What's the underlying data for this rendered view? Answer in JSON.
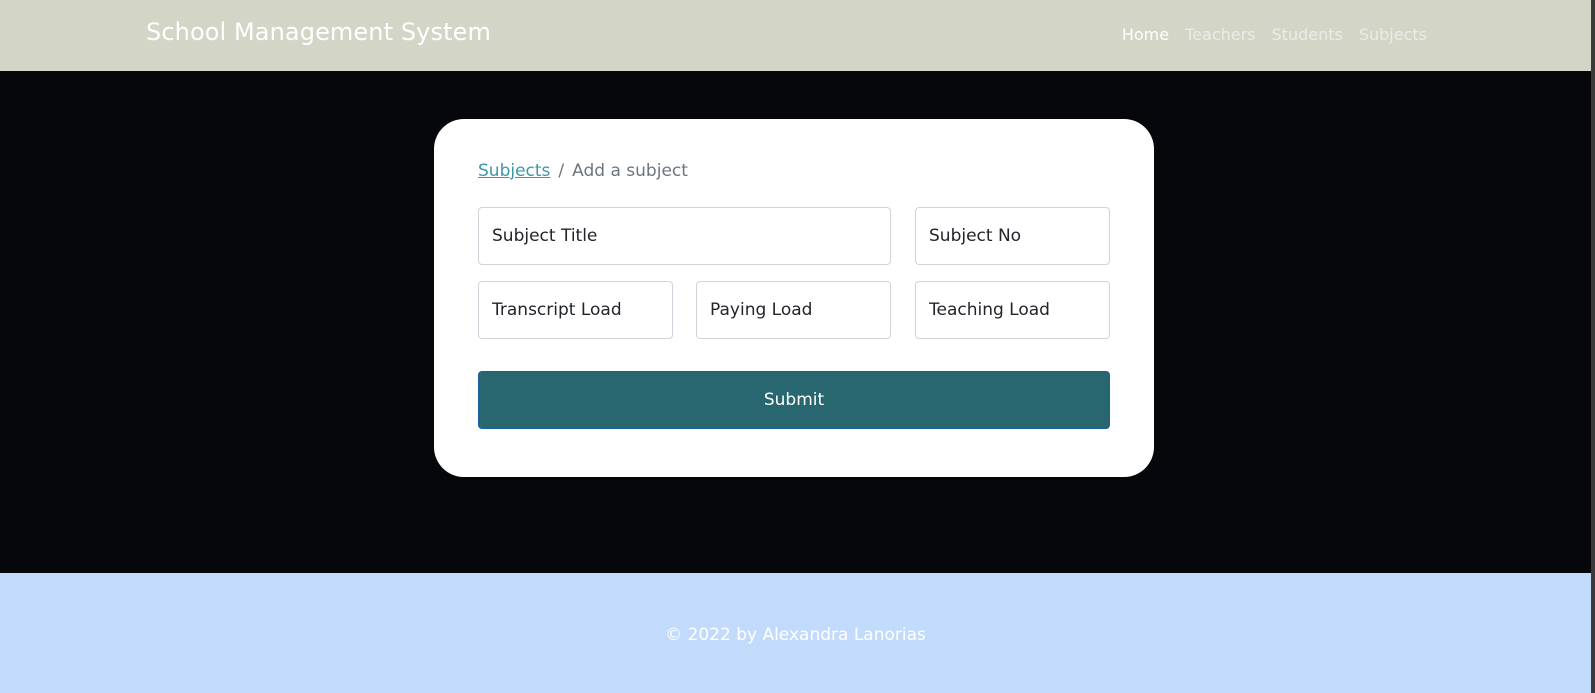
{
  "header": {
    "brand": "School Management System",
    "nav": [
      {
        "label": "Home",
        "active": true
      },
      {
        "label": "Teachers",
        "active": false
      },
      {
        "label": "Students",
        "active": false
      },
      {
        "label": "Subjects",
        "active": false
      }
    ]
  },
  "card": {
    "breadcrumb": {
      "link": "Subjects",
      "separator": "/",
      "current": "Add a subject"
    },
    "fields": {
      "subject_title": {
        "placeholder": "Subject Title",
        "value": ""
      },
      "subject_no": {
        "placeholder": "Subject No",
        "value": ""
      },
      "transcript_load": {
        "placeholder": "Transcript Load",
        "value": ""
      },
      "paying_load": {
        "placeholder": "Paying Load",
        "value": ""
      },
      "teaching_load": {
        "placeholder": "Teaching Load",
        "value": ""
      }
    },
    "submit_label": "Submit"
  },
  "footer": {
    "text": "© 2022 by Alexandra Lanorias"
  },
  "colors": {
    "header_bg": "#d3d5c7",
    "page_bg": "#06070b",
    "card_bg": "#ffffff",
    "link": "#3d97a8",
    "submit_bg": "#296770",
    "footer_bg": "#c2dbfd"
  }
}
